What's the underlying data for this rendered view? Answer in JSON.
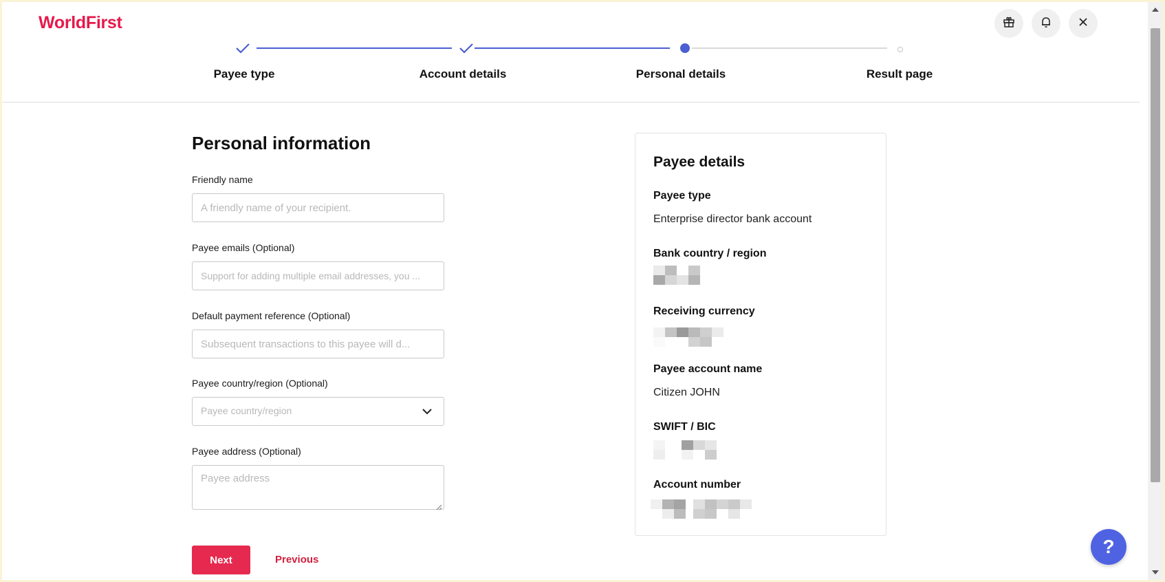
{
  "app": {
    "logo": "WorldFirst"
  },
  "header": {
    "icons": [
      "gift-icon",
      "bell-icon",
      "close-icon"
    ]
  },
  "steps": [
    {
      "label": "Payee type",
      "state": "done"
    },
    {
      "label": "Account details",
      "state": "done"
    },
    {
      "label": "Personal details",
      "state": "current"
    },
    {
      "label": "Result page",
      "state": "todo"
    }
  ],
  "form": {
    "title": "Personal information",
    "friendly_name": {
      "label": "Friendly name",
      "placeholder": "A friendly name of your recipient.",
      "value": ""
    },
    "emails": {
      "label": "Payee emails (Optional)",
      "placeholder": "Support for adding multiple email addresses, you ...",
      "value": ""
    },
    "reference": {
      "label": "Default payment reference (Optional)",
      "placeholder": "Subsequent transactions to this payee will d...",
      "value": ""
    },
    "country": {
      "label": "Payee country/region (Optional)",
      "placeholder": "Payee country/region"
    },
    "address": {
      "label": "Payee address (Optional)",
      "placeholder": "Payee address",
      "value": ""
    },
    "next_label": "Next",
    "previous_label": "Previous"
  },
  "payee": {
    "title": "Payee details",
    "payee_type_label": "Payee type",
    "payee_type_value": "Enterprise director bank account",
    "bank_country_label": "Bank country / region",
    "currency_label": "Receiving currency",
    "account_name_label": "Payee account name",
    "account_name_value": "Citizen JOHN",
    "swift_label": "SWIFT / BIC",
    "account_number_label": "Account number"
  },
  "help": {
    "label": "?"
  },
  "colors": {
    "brand": "#e6194b",
    "accent": "#4a5fd1",
    "next_button": "#e6294f",
    "help_button": "#4f63e2"
  }
}
